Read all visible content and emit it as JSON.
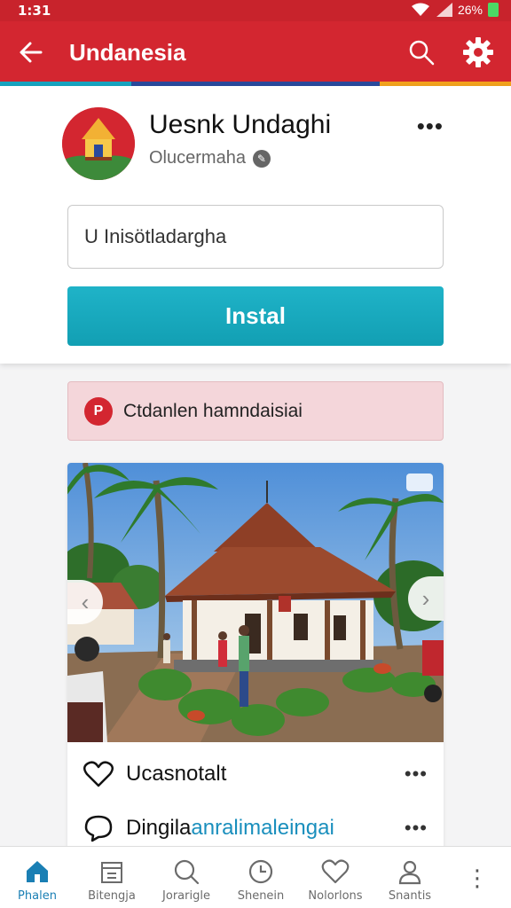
{
  "status_bar": {
    "time": "1:31",
    "battery": "26%"
  },
  "app_bar": {
    "title": "Undanesia"
  },
  "profile": {
    "name": "Uesnk Undaghi",
    "handle": "Olucermaha",
    "more": "•••",
    "input_value": "U Inisötladargha",
    "install_label": "Instal"
  },
  "alert": {
    "icon_text": "P",
    "text": "Ctdanlen hamndaisiai"
  },
  "post": {
    "like_label": "Ucasnotalt",
    "comment_label_a": "Dingila",
    "comment_label_b": "anralimaleingai",
    "more": "•••"
  },
  "bottom_nav": {
    "items": [
      {
        "label": "Phalen",
        "icon": "home-icon"
      },
      {
        "label": "Bitengja",
        "icon": "box-icon"
      },
      {
        "label": "Jorarigle",
        "icon": "search-icon"
      },
      {
        "label": "Shenein",
        "icon": "clock-icon"
      },
      {
        "label": "Nolorlons",
        "icon": "heart-icon"
      },
      {
        "label": "Snantis",
        "icon": "user-icon"
      }
    ],
    "more": "⋮"
  },
  "colors": {
    "brand_red": "#d32630",
    "accent_teal": "#17a5c0",
    "nav_active": "#1a7fb4"
  }
}
